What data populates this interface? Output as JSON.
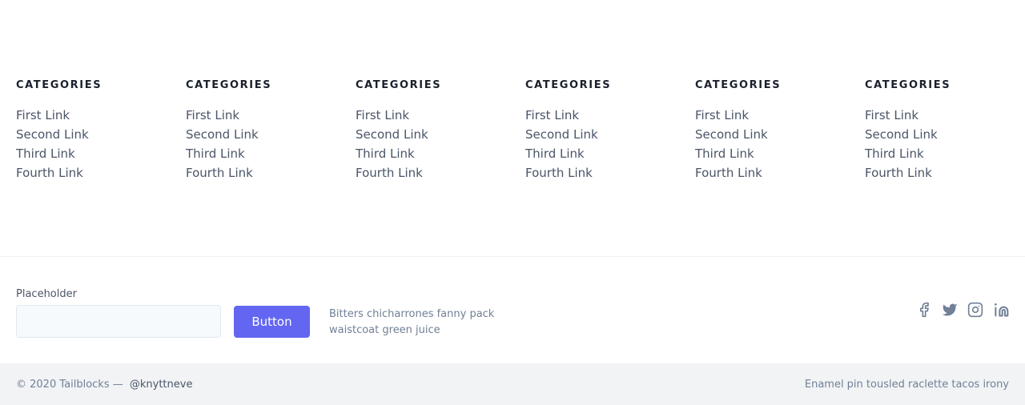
{
  "columns": [
    {
      "title": "CATEGORIES",
      "links": [
        "First Link",
        "Second Link",
        "Third Link",
        "Fourth Link"
      ]
    },
    {
      "title": "CATEGORIES",
      "links": [
        "First Link",
        "Second Link",
        "Third Link",
        "Fourth Link"
      ]
    },
    {
      "title": "CATEGORIES",
      "links": [
        "First Link",
        "Second Link",
        "Third Link",
        "Fourth Link"
      ]
    },
    {
      "title": "CATEGORIES",
      "links": [
        "First Link",
        "Second Link",
        "Third Link",
        "Fourth Link"
      ]
    },
    {
      "title": "CATEGORIES",
      "links": [
        "First Link",
        "Second Link",
        "Third Link",
        "Fourth Link"
      ]
    },
    {
      "title": "CATEGORIES",
      "links": [
        "First Link",
        "Second Link",
        "Third Link",
        "Fourth Link"
      ]
    }
  ],
  "subscribe": {
    "label": "Placeholder",
    "input_value": "",
    "button_label": "Button",
    "blurb": "Bitters chicharrones fanny pack waistcoat green juice"
  },
  "socials": [
    {
      "icon": "facebook-icon"
    },
    {
      "icon": "twitter-icon"
    },
    {
      "icon": "instagram-icon"
    },
    {
      "icon": "linkedin-icon"
    }
  ],
  "footer": {
    "copyright": "© 2020 Tailblocks —",
    "handle": "@knyttneve",
    "tagline": "Enamel pin tousled raclette tacos irony"
  },
  "colors": {
    "accent": "#6366f1",
    "footer_bg": "#f2f3f5",
    "icon": "#718096"
  }
}
